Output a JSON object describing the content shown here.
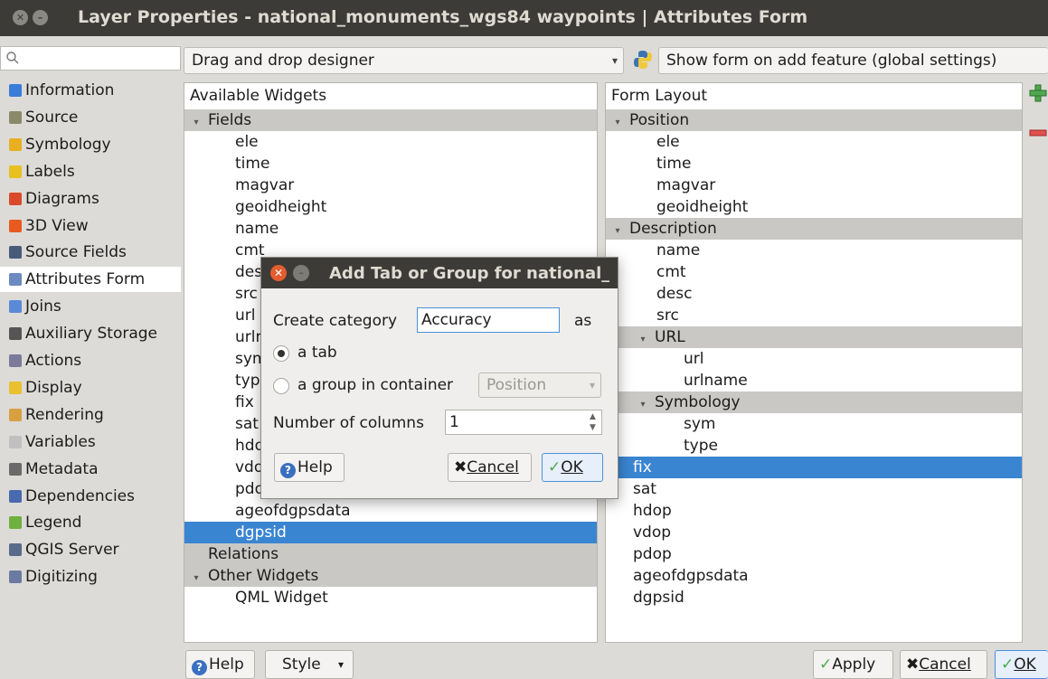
{
  "window": {
    "title": "Layer Properties - national_monuments_wgs84 waypoints | Attributes Form"
  },
  "sidebar": {
    "items": [
      {
        "label": "Information",
        "icon": "info-icon",
        "color": "#3a7dd8"
      },
      {
        "label": "Source",
        "icon": "source-icon",
        "color": "#8a8a6a"
      },
      {
        "label": "Symbology",
        "icon": "symbology-icon",
        "color": "#e8b020"
      },
      {
        "label": "Labels",
        "icon": "labels-icon",
        "color": "#e8c020"
      },
      {
        "label": "Diagrams",
        "icon": "diagrams-icon",
        "color": "#d94a2a"
      },
      {
        "label": "3D View",
        "icon": "3d-view-icon",
        "color": "#e85a20"
      },
      {
        "label": "Source Fields",
        "icon": "source-fields-icon",
        "color": "#4a5a7a"
      },
      {
        "label": "Attributes Form",
        "icon": "attributes-form-icon",
        "color": "#6a8ac0"
      },
      {
        "label": "Joins",
        "icon": "joins-icon",
        "color": "#5a8ad8"
      },
      {
        "label": "Auxiliary Storage",
        "icon": "auxiliary-storage-icon",
        "color": "#555555"
      },
      {
        "label": "Actions",
        "icon": "actions-icon",
        "color": "#7a7a9a"
      },
      {
        "label": "Display",
        "icon": "display-icon",
        "color": "#e8c030"
      },
      {
        "label": "Rendering",
        "icon": "rendering-icon",
        "color": "#d8a040"
      },
      {
        "label": "Variables",
        "icon": "variables-icon",
        "color": "#c0c0c0"
      },
      {
        "label": "Metadata",
        "icon": "metadata-icon",
        "color": "#6a6a6a"
      },
      {
        "label": "Dependencies",
        "icon": "dependencies-icon",
        "color": "#4a6ab0"
      },
      {
        "label": "Legend",
        "icon": "legend-icon",
        "color": "#70b040"
      },
      {
        "label": "QGIS Server",
        "icon": "qgis-server-icon",
        "color": "#5a6a8a"
      },
      {
        "label": "Digitizing",
        "icon": "digitizing-icon",
        "color": "#6a7aa0"
      }
    ],
    "selected": "Attributes Form"
  },
  "toolbar": {
    "designer_mode": "Drag and drop designer",
    "form_option": "Show form on add feature (global settings)"
  },
  "available_widgets": {
    "header": "Available Widgets",
    "groups": [
      {
        "label": "Fields",
        "items": [
          "ele",
          "time",
          "magvar",
          "geoidheight",
          "name",
          "cmt",
          "desc",
          "src",
          "url",
          "urlname",
          "sym",
          "type",
          "fix",
          "sat",
          "hdop",
          "vdop",
          "pdop",
          "ageofdgpsdata",
          "dgpsid"
        ]
      },
      {
        "label": "Relations"
      },
      {
        "label": "Other Widgets",
        "items": [
          "QML Widget"
        ]
      }
    ],
    "selected": "dgpsid"
  },
  "form_layout": {
    "header": "Form Layout",
    "position_group": "Position",
    "position_items": [
      "ele",
      "time",
      "magvar",
      "geoidheight"
    ],
    "description_group": "Description",
    "description_items": [
      "name",
      "cmt",
      "desc",
      "src"
    ],
    "url_group": "URL",
    "url_items": [
      "url",
      "urlname"
    ],
    "symbology_group": "Symbology",
    "symbology_items": [
      "sym",
      "type"
    ],
    "loose_items": [
      "fix",
      "sat",
      "hdop",
      "vdop",
      "pdop",
      "ageofdgpsdata",
      "dgpsid"
    ],
    "selected": "fix"
  },
  "bottom": {
    "help": "Help",
    "style": "Style",
    "apply": "Apply",
    "cancel": "Cancel",
    "ok": "OK"
  },
  "dialog": {
    "title": "Add Tab or Group for national_",
    "create_category_label": "Create category",
    "category_value": "Accuracy",
    "as_label": "as",
    "option_tab": "a tab",
    "option_group": "a group in container",
    "container_value": "Position",
    "columns_label": "Number of columns",
    "columns_value": "1",
    "help": "Help",
    "cancel": "Cancel",
    "ok": "OK"
  }
}
